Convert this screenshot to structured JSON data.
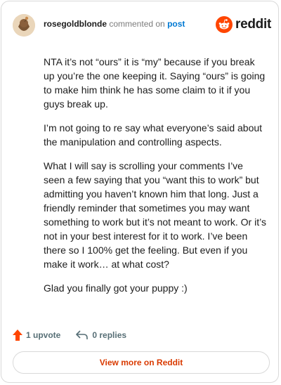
{
  "comment": {
    "username": "rosegoldblonde",
    "action_text": "commented on",
    "post_link": "post",
    "paragraphs": [
      "NTA it’s not “ours” it is “my” because if you break up you’re the one keeping it. Saying “ours” is going to make him think he has some claim to it if you guys break up.",
      "I’m not going to re say what everyone’s said about the manipulation and controlling aspects.",
      "What I will say is scrolling your comments I’ve seen a few saying that you “want this to work” but admitting you haven’t known him that long. Just a friendly reminder that sometimes you may want something to work but it’s not meant to work. Or it’s not in your best interest for it to work. I’ve been there so I 100% get the feeling. But even if you make it work… at what cost?",
      "Glad you finally got your puppy :)"
    ]
  },
  "brand": {
    "name": "reddit",
    "color": "#ff4500"
  },
  "actions": {
    "upvote_label": "1 upvote",
    "replies_label": "0 replies"
  },
  "footer": {
    "view_more_label": "View more on Reddit"
  },
  "colors": {
    "link": "#0079d3",
    "accent": "#d93a00",
    "upvote": "#ff4500",
    "muted": "#576f76"
  },
  "icons": [
    "avatar",
    "reddit-logo-icon",
    "upvote-icon",
    "reply-icon"
  ]
}
